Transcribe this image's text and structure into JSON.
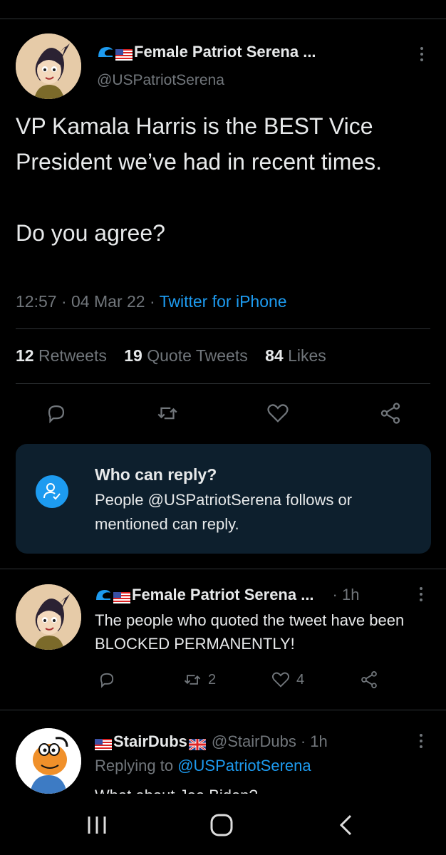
{
  "main_tweet": {
    "display_name": "Female Patriot Serena ...",
    "handle": "@USPatriotSerena",
    "text": "VP Kamala Harris is the BEST Vice President we’ve had in recent times.\n\nDo you agree?",
    "time": "12:57",
    "date": "04 Mar 22",
    "source": "Twitter for iPhone",
    "retweets_count": "12",
    "retweets_label": "Retweets",
    "quotes_count": "19",
    "quotes_label": "Quote Tweets",
    "likes_count": "84",
    "likes_label": "Likes"
  },
  "reply_restriction": {
    "title": "Who can reply?",
    "description": "People @USPatriotSerena follows or mentioned can reply."
  },
  "replies": [
    {
      "display_name": "Female Patriot Serena ...",
      "time": "· 1h",
      "text": "The people who quoted the tweet have been BLOCKED PERMANENTLY!",
      "retweets": "2",
      "likes": "4"
    },
    {
      "display_name": "StairDubs",
      "handle": "@StairDubs",
      "time": "· 1h",
      "replying_prefix": "Replying to",
      "replying_to": "@USPatriotSerena",
      "text": "What about Joe Biden?"
    }
  ],
  "colors": {
    "accent": "#1d9bf0",
    "muted": "#71767b",
    "background": "#000000",
    "reply_box": "#0d1f2d"
  },
  "icons": {
    "name_prefix": [
      "wave-icon",
      "us-flag-icon"
    ],
    "actions": [
      "reply-icon",
      "retweet-icon",
      "like-icon",
      "share-icon"
    ],
    "nav": [
      "recents-icon",
      "home-icon",
      "back-icon"
    ]
  }
}
